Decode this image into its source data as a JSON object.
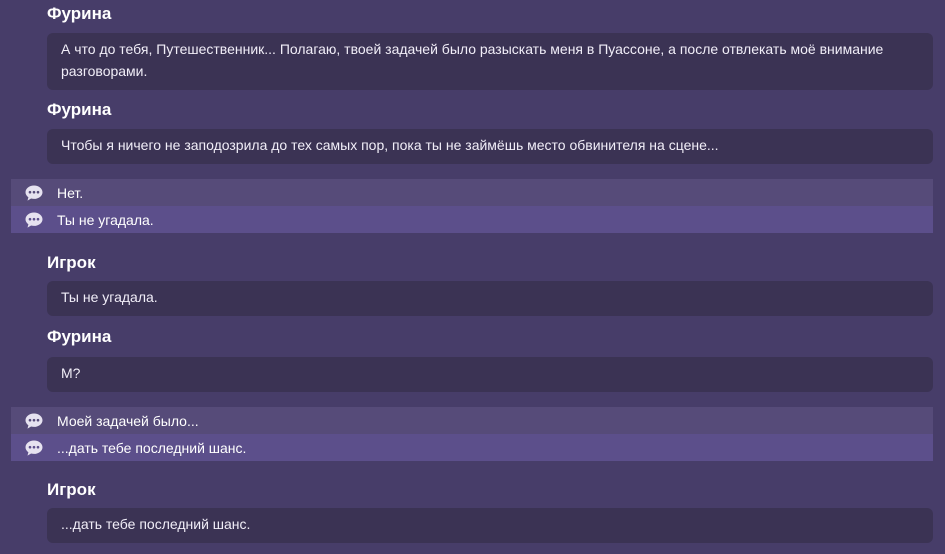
{
  "dialogue": [
    {
      "type": "line",
      "speaker": "Фурина",
      "text": "А что до тебя, Путешественник... Полагаю, твоей задачей было разыскать меня в Пуассоне, а после отвлекать моё внимание разговорами."
    },
    {
      "type": "line",
      "speaker": "Фурина",
      "text": "Чтобы я ничего не заподозрила до тех самых пор, пока ты не займёшь место обвинителя на сцене..."
    },
    {
      "type": "choices",
      "options": [
        {
          "label": "Нет.",
          "icon": "speech-bubble-icon"
        },
        {
          "label": "Ты не угадала.",
          "icon": "speech-bubble-icon"
        }
      ]
    },
    {
      "type": "line",
      "speaker": "Игрок",
      "text": "Ты не угадала."
    },
    {
      "type": "line",
      "speaker": "Фурина",
      "text": "М?"
    },
    {
      "type": "choices",
      "options": [
        {
          "label": "Моей задачей было...",
          "icon": "speech-bubble-icon"
        },
        {
          "label": "...дать тебе последний шанс.",
          "icon": "speech-bubble-icon"
        }
      ]
    },
    {
      "type": "line",
      "speaker": "Игрок",
      "text": "...дать тебе последний шанс."
    }
  ],
  "colors": {
    "background": "#473d69",
    "bubble": "#3b3354",
    "choice_row": "#564b79",
    "choice_row_selected": "#5c4f8b",
    "icon": "#e6e2f0"
  }
}
